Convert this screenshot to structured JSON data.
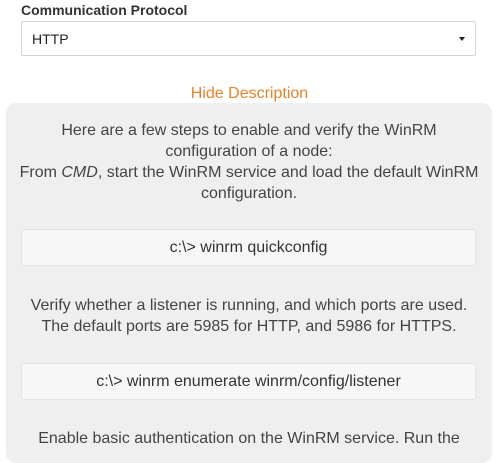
{
  "protocol_field": {
    "label": "Communication Protocol",
    "selected": "HTTP"
  },
  "toggle_label": "Hide Description",
  "description": {
    "step1_line1": "Here are a few steps to enable and verify the WinRM",
    "step1_line2": "configuration of a node:",
    "step1_line3_prefix": "From ",
    "step1_line3_em": "CMD",
    "step1_line3_suffix": ", start the WinRM service and load the default WinRM",
    "step1_line4": "configuration.",
    "command1": "c:\\> winrm quickconfig",
    "step2_line1": "Verify whether a listener is running, and which ports are used.",
    "step2_line2": "The default ports are 5985 for HTTP, and 5986 for HTTPS.",
    "command2": "c:\\> winrm enumerate winrm/config/listener",
    "step3_line1": "Enable basic authentication on the WinRM service. Run the"
  }
}
